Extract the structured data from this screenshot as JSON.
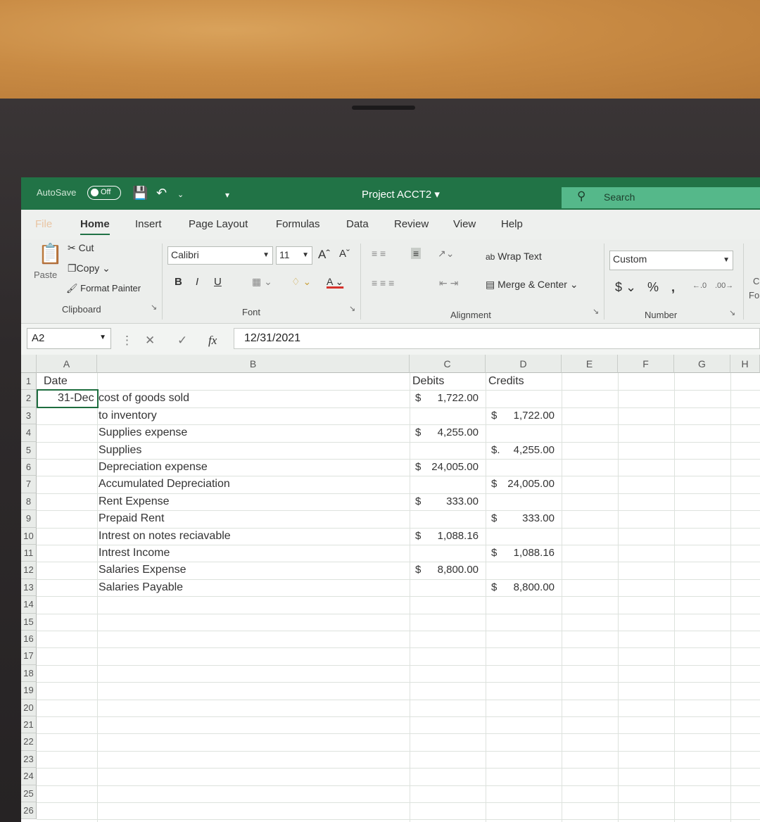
{
  "title_bar": {
    "autosave_label": "AutoSave",
    "autosave_state": "Off",
    "document_title": "Project ACCT2",
    "search_placeholder": "Search"
  },
  "tabs": [
    "File",
    "Home",
    "Insert",
    "Page Layout",
    "Formulas",
    "Data",
    "Review",
    "View",
    "Help"
  ],
  "ribbon": {
    "clipboard": {
      "paste": "Paste",
      "cut": "Cut",
      "copy": "Copy",
      "format_painter": "Format Painter",
      "label": "Clipboard"
    },
    "font": {
      "name": "Calibri",
      "size": "11",
      "label": "Font",
      "bold": "B",
      "italic": "I",
      "underline": "U"
    },
    "alignment": {
      "wrap_text": "Wrap Text",
      "merge_center": "Merge & Center",
      "label": "Alignment"
    },
    "number": {
      "format": "Custom",
      "currency": "$",
      "percent": "%",
      "comma": ",",
      "label": "Number"
    },
    "cut_off": {
      "top": "C",
      "bottom": "Fo"
    }
  },
  "formula_bar": {
    "cell_ref": "A2",
    "fx": "fx",
    "value": "12/31/2021"
  },
  "columns": [
    "A",
    "B",
    "C",
    "D",
    "E",
    "F",
    "G",
    "H"
  ],
  "rows": [
    "1",
    "2",
    "3",
    "4",
    "5",
    "6",
    "7",
    "8",
    "9",
    "10",
    "11",
    "12",
    "13",
    "14",
    "15",
    "16",
    "17",
    "18",
    "19",
    "20",
    "21",
    "22",
    "23",
    "24",
    "25",
    "26"
  ],
  "sheet": {
    "header": {
      "date": "Date",
      "debits": "Debits",
      "credits": "Credits"
    },
    "a2": "31-Dec",
    "accounts": [
      "cost of goods sold",
      "to inventory",
      "Supplies expense",
      "Supplies",
      "Depreciation expense",
      "Accumulated Depreciation",
      "Rent Expense",
      "Prepaid Rent",
      "Intrest on notes reciavable",
      "Intrest Income",
      "Salaries Expense",
      "Salaries Payable"
    ],
    "debits": [
      {
        "sym": "$",
        "amount": "1,722.00"
      },
      {
        "sym": "$",
        "amount": "4,255.00"
      },
      {
        "sym": "$",
        "amount": "24,005.00"
      },
      {
        "sym": "$",
        "amount": "333.00"
      },
      {
        "sym": "$",
        "amount": "1,088.16"
      },
      {
        "sym": "$",
        "amount": "8,800.00"
      }
    ],
    "credits": [
      {
        "sym": "$",
        "amount": "1,722.00"
      },
      {
        "sym": "$.",
        "amount": "4,255.00"
      },
      {
        "sym": "$",
        "amount": "24,005.00"
      },
      {
        "sym": "$",
        "amount": "333.00"
      },
      {
        "sym": "$",
        "amount": "1,088.16"
      },
      {
        "sym": "$",
        "amount": "8,800.00"
      }
    ]
  },
  "colors": {
    "accent": "#217346",
    "search": "#55b88a"
  }
}
